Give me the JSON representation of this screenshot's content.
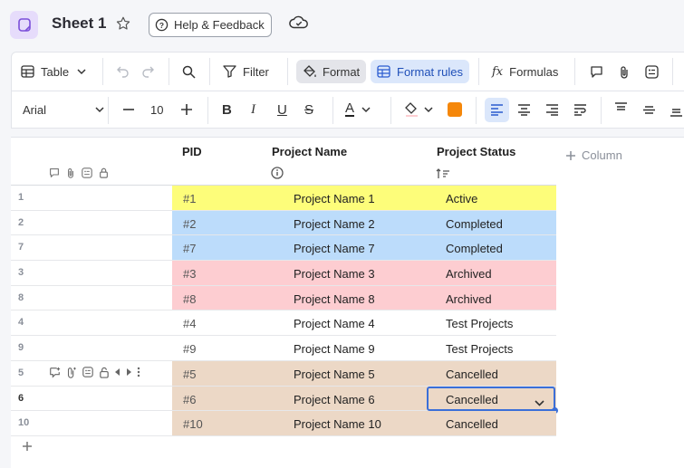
{
  "title_bar": {
    "sheet_name": "Sheet 1",
    "help_label": "Help & Feedback"
  },
  "toolbar": {
    "view_label": "Table",
    "filter_label": "Filter",
    "format_label": "Format",
    "format_rules_label": "Format rules",
    "formulas_label": "Formulas",
    "font_name": "Arial",
    "font_size": "10",
    "fill_color": "#f5870a"
  },
  "columns": {
    "pid": "PID",
    "name": "Project Name",
    "status": "Project Status",
    "add_column": "Column"
  },
  "rows": [
    {
      "num": "1",
      "pid": "#1",
      "name": "Project Name 1",
      "status": "Active",
      "color": "#fdfd7a"
    },
    {
      "num": "2",
      "pid": "#2",
      "name": "Project Name 2",
      "status": "Completed",
      "color": "#bcdcfb"
    },
    {
      "num": "7",
      "pid": "#7",
      "name": "Project Name 7",
      "status": "Completed",
      "color": "#bcdcfb"
    },
    {
      "num": "3",
      "pid": "#3",
      "name": "Project Name 3",
      "status": "Archived",
      "color": "#fdcdd1"
    },
    {
      "num": "8",
      "pid": "#8",
      "name": "Project Name 8",
      "status": "Archived",
      "color": "#fdcdd1"
    },
    {
      "num": "4",
      "pid": "#4",
      "name": "Project Name 4",
      "status": "Test Projects",
      "color": "#ffffff"
    },
    {
      "num": "9",
      "pid": "#9",
      "name": "Project Name 9",
      "status": "Test Projects",
      "color": "#ffffff"
    },
    {
      "num": "5",
      "pid": "#5",
      "name": "Project Name 5",
      "status": "Cancelled",
      "color": "#ecd8c6"
    },
    {
      "num": "6",
      "pid": "#6",
      "name": "Project Name 6",
      "status": "Cancelled",
      "color": "#ecd8c6"
    },
    {
      "num": "10",
      "pid": "#10",
      "name": "Project Name 10",
      "status": "Cancelled",
      "color": "#ecd8c6"
    }
  ]
}
